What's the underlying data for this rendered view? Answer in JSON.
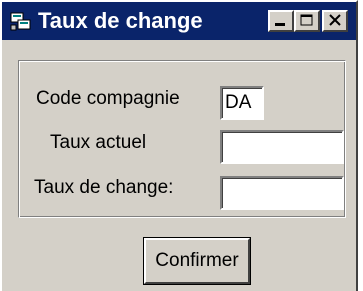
{
  "window": {
    "title": "Taux de change",
    "icon": "app-icon",
    "controls": {
      "minimize": "minimize-icon",
      "maximize": "maximize-icon",
      "close": "close-icon"
    }
  },
  "form": {
    "code_label": "Code compagnie",
    "code_value": "DA",
    "taux_actuel_label": "Taux actuel",
    "taux_actuel_value": "",
    "taux_change_label": "Taux de change:",
    "taux_change_value": ""
  },
  "actions": {
    "confirm_label": "Confirmer"
  },
  "colors": {
    "titlebar": "#0a246a",
    "face": "#d4d0c8"
  }
}
